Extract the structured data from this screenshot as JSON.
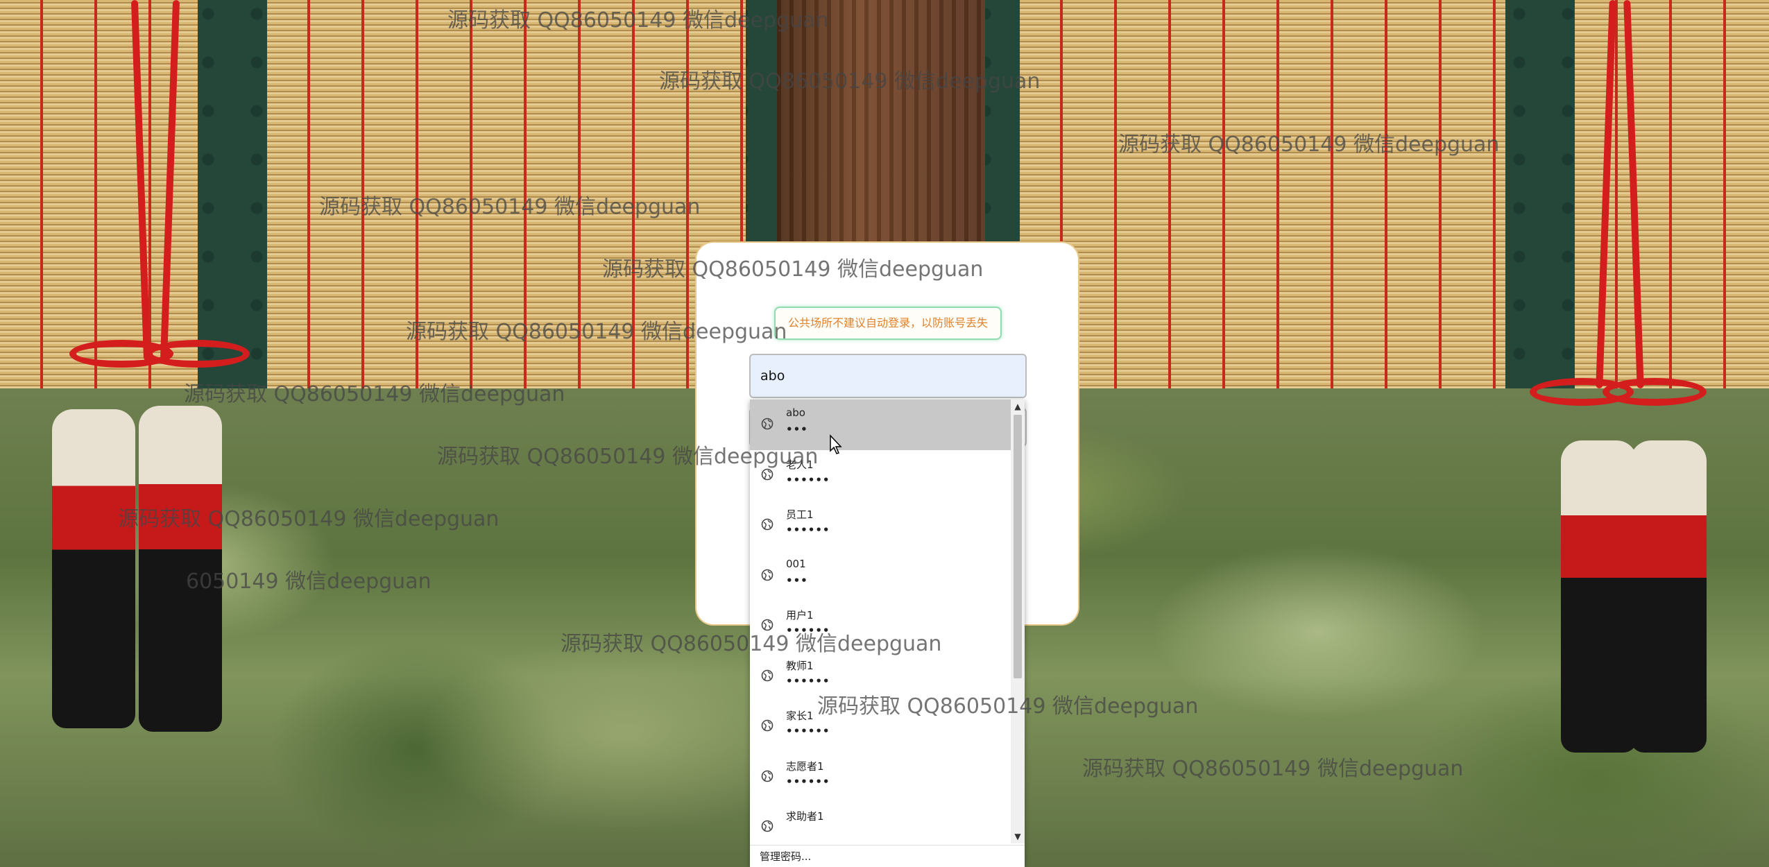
{
  "notice": {
    "text": "公共场所不建议自动登录，以防账号丢失"
  },
  "username_field": {
    "value": "abo"
  },
  "autofill": {
    "items": [
      {
        "username": "abo",
        "password_mask": "•••",
        "highlighted": true
      },
      {
        "username": "老人1",
        "password_mask": "••••••",
        "highlighted": false
      },
      {
        "username": "员工1",
        "password_mask": "••••••",
        "highlighted": false
      },
      {
        "username": "001",
        "password_mask": "•••",
        "highlighted": false
      },
      {
        "username": "用户1",
        "password_mask": "••••••",
        "highlighted": false
      },
      {
        "username": "教师1",
        "password_mask": "••••••",
        "highlighted": false
      },
      {
        "username": "家长1",
        "password_mask": "••••••",
        "highlighted": false
      },
      {
        "username": "志愿者1",
        "password_mask": "••••••",
        "highlighted": false
      },
      {
        "username": "求助者1",
        "password_mask": "",
        "highlighted": false
      }
    ],
    "manage_label": "管理密码...",
    "item_icon": "globe-icon"
  },
  "watermark": {
    "text": "源码获取 QQ86050149 微信deepguan",
    "partial_text": "6050149 微信deepguan"
  },
  "colors": {
    "notice_text": "#e0812c",
    "notice_border": "#8fdcb0",
    "field_background": "#e8f0fe",
    "highlight": "#c8c8c8"
  }
}
